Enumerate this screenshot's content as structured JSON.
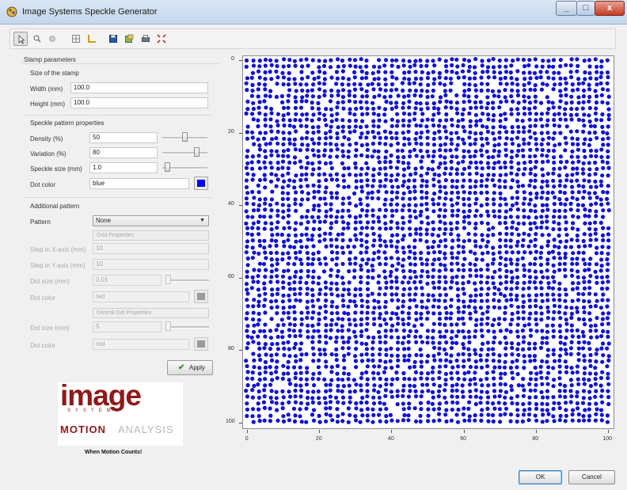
{
  "window": {
    "title": "Image Systems Speckle Generator",
    "close_symbol": "x",
    "minimize_symbol": "_",
    "maximize_symbol": "□"
  },
  "toolbar": {
    "icons": [
      "pointer-icon",
      "zoom-icon",
      "pan-icon",
      "grid-icon",
      "axes-icon",
      "save-icon",
      "export-icon",
      "print-icon",
      "fit-icon"
    ]
  },
  "stamp": {
    "group_title": "Stamp parameters",
    "size_title": "Size of the stamp",
    "width_label": "Width (mm)",
    "width_value": "100.0",
    "height_label": "Height (mm)",
    "height_value": "100.0"
  },
  "speckle": {
    "group_title": "Speckle pattern properties",
    "density_label": "Density (%)",
    "density_value": "50",
    "density_level": 0.5,
    "variation_label": "Variation (%)",
    "variation_value": "80",
    "variation_level": 0.8,
    "size_label": "Speckle size (mm)",
    "size_value": "1.0",
    "size_level": 0.05,
    "color_label": "Dot color",
    "color_value": "blue",
    "color_hex": "#0000ee"
  },
  "additional": {
    "group_title": "Additional pattern",
    "pattern_label": "Pattern",
    "pattern_value": "None",
    "grid_header": "Grid Properties",
    "step_x_label": "Step in X-axis (mm)",
    "step_x_value": "10",
    "step_y_label": "Step in Y-axis (mm)",
    "step_y_value": "10",
    "grid_dot_size_label": "Dot size (mm)",
    "grid_dot_size_value": "0.01",
    "grid_dot_color_label": "Dot color",
    "grid_dot_color_value": "red",
    "central_header": "Central Dot Properties",
    "central_dot_size_label": "Dot size (mm)",
    "central_dot_size_value": "5",
    "central_dot_color_label": "Dot color",
    "central_dot_color_value": "red"
  },
  "apply_label": "Apply",
  "logo": {
    "image": "image",
    "systems": "SYSTEMS",
    "motion": "MOTION",
    "analysis": "ANALYSIS",
    "tagline": "When Motion Counts!"
  },
  "plot": {
    "x_ticks": [
      "0",
      "20",
      "40",
      "60",
      "80",
      "100"
    ],
    "y_ticks": [
      "0",
      "20",
      "40",
      "60",
      "80",
      "100"
    ],
    "xlim": [
      0,
      100
    ],
    "ylim": [
      0,
      100
    ],
    "dot_color": "#1010d6",
    "speckle_size_mm": 1.0
  },
  "buttons": {
    "ok": "OK",
    "cancel": "Cancel"
  }
}
